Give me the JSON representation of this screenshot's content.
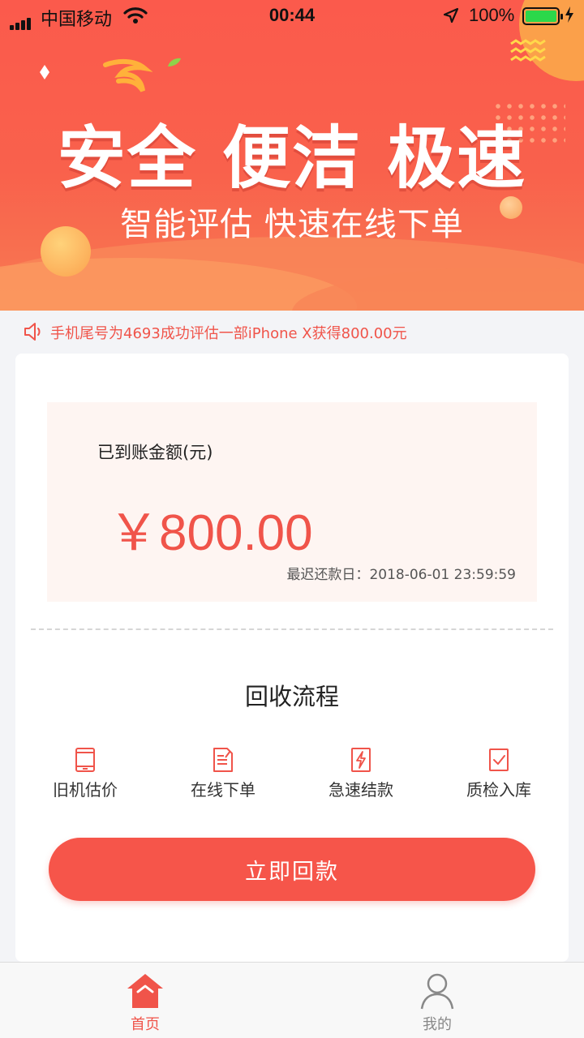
{
  "status_bar": {
    "carrier": "中国移动",
    "time": "00:44",
    "battery": "100%"
  },
  "banner": {
    "headline": "安全 便洁 极速",
    "subline": "智能评估 快速在线下单"
  },
  "notice": {
    "text": "手机尾号为4693成功评估一部iPhone X获得800.00元"
  },
  "amount_card": {
    "label": "已到账金额(元)",
    "value": "￥800.00",
    "due_label": "最迟还款日：",
    "due_value": "2018-06-01 23:59:59"
  },
  "process": {
    "title": "回收流程",
    "steps": [
      {
        "label": "旧机估价",
        "icon": "phone-icon"
      },
      {
        "label": "在线下单",
        "icon": "document-edit-icon"
      },
      {
        "label": "急速结款",
        "icon": "lightning-icon"
      },
      {
        "label": "质检入库",
        "icon": "checkbox-icon"
      }
    ]
  },
  "cta": {
    "label": "立即回款"
  },
  "tabbar": {
    "items": [
      {
        "label": "首页",
        "icon": "home-icon",
        "active": true
      },
      {
        "label": "我的",
        "icon": "user-icon",
        "active": false
      }
    ]
  },
  "colors": {
    "accent": "#f0544a",
    "banner_top": "#fb5a4c",
    "amount_bg": "#fef5f2"
  }
}
